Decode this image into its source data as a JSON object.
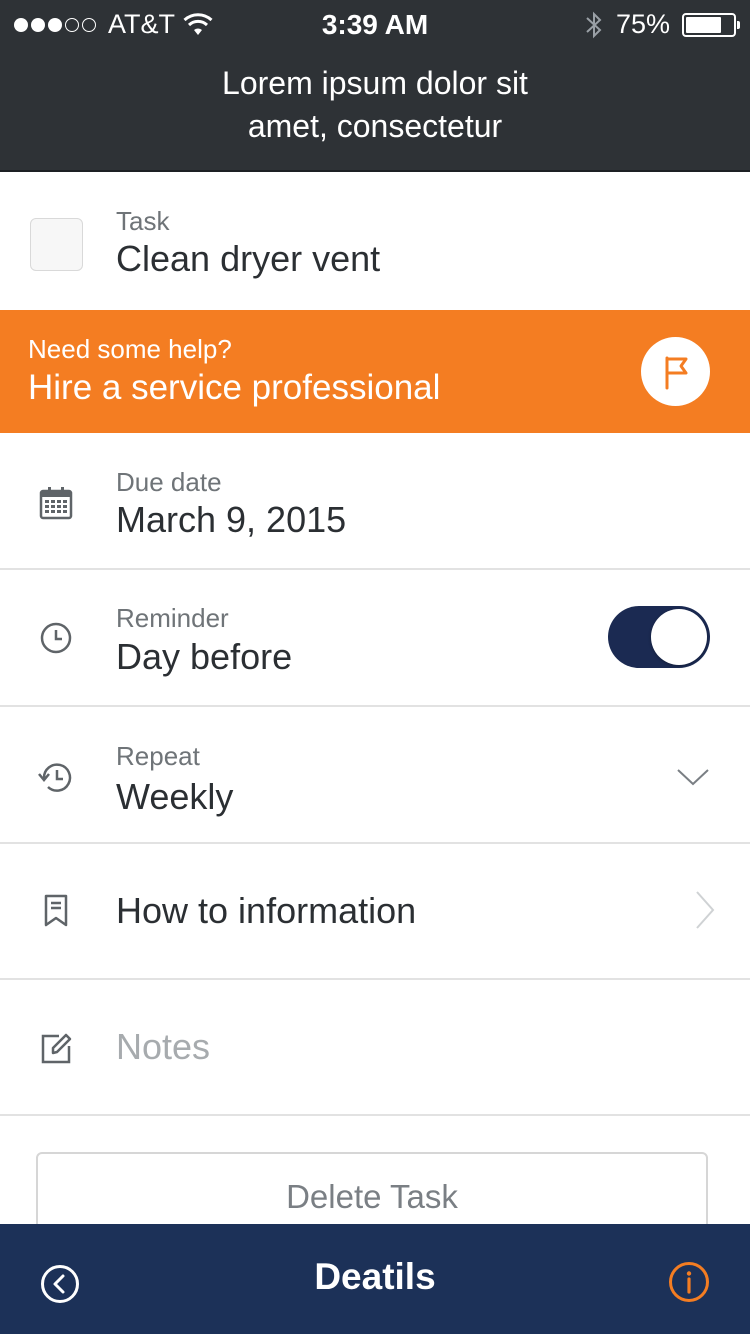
{
  "status_bar": {
    "carrier": "AT&T",
    "time": "3:39 AM",
    "battery": "75%",
    "battery_level": 0.75,
    "signal_bars": 3
  },
  "header": {
    "title_line1": "Lorem ipsum dolor sit",
    "title_line2": "amet, consectetur"
  },
  "task": {
    "label": "Task",
    "value": "Clean dryer vent",
    "checked": false
  },
  "help_banner": {
    "small": "Need some help?",
    "big": "Hire a service professional",
    "icon": "flag-icon"
  },
  "rows": {
    "due_date": {
      "label": "Due date",
      "value": "March 9, 2015",
      "icon": "calendar-icon"
    },
    "reminder": {
      "label": "Reminder",
      "value": "Day before",
      "icon": "clock-icon",
      "enabled": true
    },
    "repeat": {
      "label": "Repeat",
      "value": "Weekly",
      "icon": "history-icon"
    },
    "how_to": {
      "value": "How to information",
      "icon": "bookmark-icon"
    },
    "notes": {
      "placeholder": "Notes",
      "icon": "edit-icon"
    }
  },
  "delete_button": "Delete Task",
  "tabbar": {
    "title": "Deatils",
    "back_icon": "back-circle-icon",
    "info_icon": "info-icon"
  },
  "colors": {
    "header_bg": "#2e3236",
    "accent_orange": "#f47d22",
    "navy": "#1c3158",
    "toggle_on": "#1b2a52"
  }
}
